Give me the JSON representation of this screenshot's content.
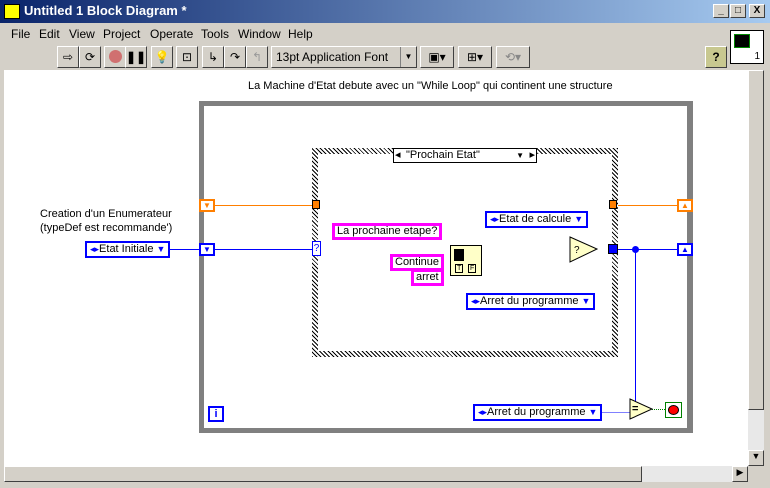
{
  "window": {
    "title": "Untitled 1 Block Diagram *",
    "controls": [
      "_",
      "□",
      "X"
    ]
  },
  "menu": [
    "File",
    "Edit",
    "View",
    "Project",
    "Operate",
    "Tools",
    "Window",
    "Help"
  ],
  "toolbar": {
    "font": "13pt Application Font",
    "help": "?"
  },
  "diagram": {
    "comment": "La Machine d'Etat debute avec un \"While Loop\" qui continent une structure",
    "enum_label_1": "Creation d'un Enumerateur",
    "enum_label_2": "(typeDef est recommande')",
    "initial_enum": "Etat Initiale",
    "case_selector": "\"Prochain Etat\"",
    "selector_terminal": "?",
    "prompt_string": "La prochaine etape?",
    "button1_string": "Continue",
    "button2_string": "arret",
    "true_enum": "Etat de calcule",
    "false_enum": "Arret du programme",
    "compare_enum": "Arret du programme",
    "equal_symbol": "=",
    "iteration": "i",
    "dialog_t": "T",
    "dialog_f": "F",
    "vi_icon_number": "1"
  },
  "colors": {
    "enum_wire": "#0000ff",
    "cluster_wire": "#ff7f00",
    "string": "#ff00ff",
    "bool": "#008000"
  }
}
